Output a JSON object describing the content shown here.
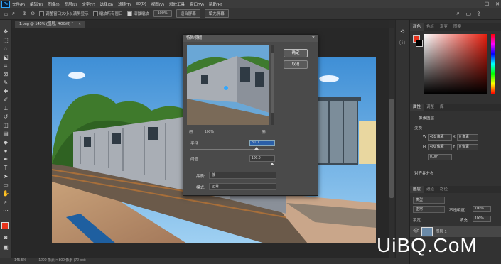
{
  "app": {
    "logo": "Ps"
  },
  "menu": [
    "文件(F)",
    "编辑(E)",
    "图像(I)",
    "图层(L)",
    "文字(Y)",
    "选择(S)",
    "滤镜(T)",
    "3D(D)",
    "视图(V)",
    "增效工具",
    "窗口(W)",
    "帮助(H)"
  ],
  "window_controls": {
    "minimize": "—",
    "maximize": "☐",
    "close": "✕"
  },
  "options": {
    "zoom_all_windows": "调整窗口大小以满屏显示",
    "zoom_all": "缩放所有窗口",
    "scrubby_zoom": "细微缩放",
    "zoom_value": "100%",
    "fit_screen": "适合屏幕",
    "fill_screen": "填充屏幕"
  },
  "document_tab": {
    "title": "1.png @ 145% (图层, RGB/8) *",
    "close": "×"
  },
  "status": {
    "zoom": "145.5%",
    "info": "1200 像素 × 800 像素 (72 ppi)"
  },
  "dialog": {
    "title": "特殊模糊",
    "close": "×",
    "ok": "确定",
    "cancel": "取消",
    "preview_zoom": "100%",
    "radius_label": "半径",
    "radius_value": "80.0",
    "threshold_label": "阈值",
    "threshold_value": "100.0",
    "quality_label": "品质:",
    "quality_value": "低",
    "mode_label": "模式:",
    "mode_value": "正常",
    "radius_fraction": 0.8,
    "threshold_fraction": 0.4
  },
  "panels": {
    "color_tabs": [
      "颜色",
      "色板",
      "渐变",
      "图案"
    ],
    "properties_tabs": [
      "属性",
      "调整",
      "库"
    ],
    "properties_subtitle": "像素图层",
    "transform_label": "变换",
    "w_label": "W",
    "w_value": "451 像素",
    "h_label": "H",
    "h_value": "490 像素",
    "x_label": "X",
    "x_value": "0 像素",
    "y_label": "Y",
    "y_value": "0 像素",
    "angle_value": "0.00°",
    "align_label": "对齐并分布",
    "layers_tabs": [
      "图层",
      "通道",
      "路径"
    ],
    "layer_kind": "类型",
    "blend_mode": "正常",
    "opacity_label": "不透明度:",
    "opacity_value": "100%",
    "lock_label": "锁定:",
    "fill_label": "填充:",
    "fill_value": "100%",
    "layer_name": "图层 1"
  },
  "colors": {
    "foreground": "#e8331c",
    "background": "#000000",
    "accent": "#31a8ff"
  },
  "watermark": "UiBQ.CoM"
}
